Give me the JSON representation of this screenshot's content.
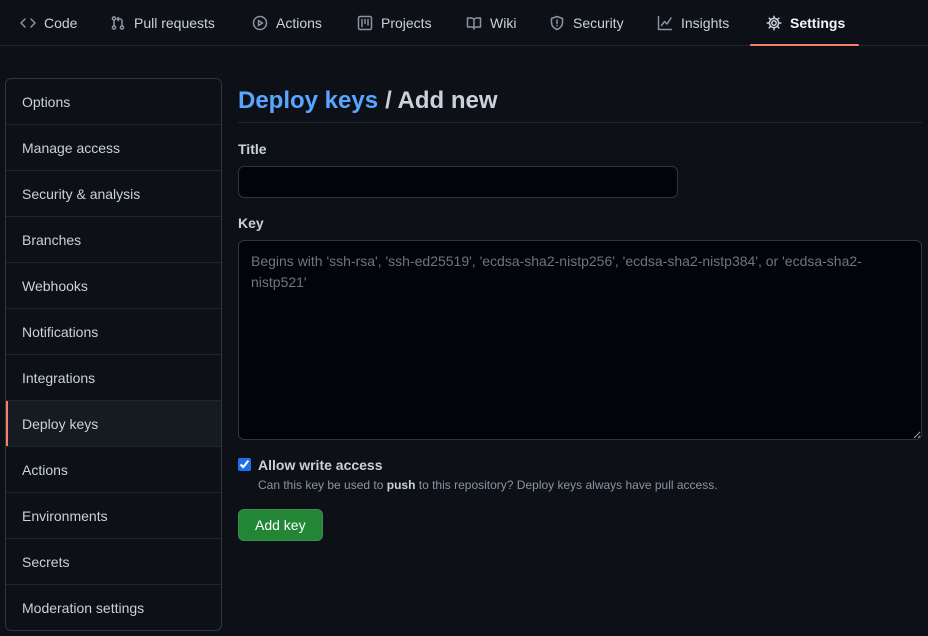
{
  "topnav": {
    "tabs": [
      {
        "label": "Code",
        "icon": "code-icon"
      },
      {
        "label": "Pull requests",
        "icon": "pull-request-icon"
      },
      {
        "label": "Actions",
        "icon": "play-icon"
      },
      {
        "label": "Projects",
        "icon": "project-icon"
      },
      {
        "label": "Wiki",
        "icon": "book-icon"
      },
      {
        "label": "Security",
        "icon": "shield-icon"
      },
      {
        "label": "Insights",
        "icon": "graph-icon"
      },
      {
        "label": "Settings",
        "icon": "gear-icon",
        "active": true
      }
    ]
  },
  "sidebar": {
    "items": [
      {
        "label": "Options"
      },
      {
        "label": "Manage access"
      },
      {
        "label": "Security & analysis"
      },
      {
        "label": "Branches"
      },
      {
        "label": "Webhooks"
      },
      {
        "label": "Notifications"
      },
      {
        "label": "Integrations"
      },
      {
        "label": "Deploy keys",
        "selected": true
      },
      {
        "label": "Actions"
      },
      {
        "label": "Environments"
      },
      {
        "label": "Secrets"
      },
      {
        "label": "Moderation settings"
      }
    ]
  },
  "main": {
    "breadcrumb_link": "Deploy keys",
    "breadcrumb_rest": "/ Add new",
    "title_label": "Title",
    "title_value": "",
    "key_label": "Key",
    "key_value": "",
    "key_placeholder": "Begins with 'ssh-rsa', 'ssh-ed25519', 'ecdsa-sha2-nistp256', 'ecdsa-sha2-nistp384', or 'ecdsa-sha2-nistp521'",
    "write_access_label": "Allow write access",
    "write_access_checked": true,
    "note_before": "Can this key be used to ",
    "note_bold": "push",
    "note_after": " to this repository? Deploy keys always have pull access.",
    "submit_label": "Add key"
  },
  "colors": {
    "background": "#0d1117",
    "link": "#58a6ff",
    "accent_underline": "#f78166",
    "button_green": "#238636"
  }
}
